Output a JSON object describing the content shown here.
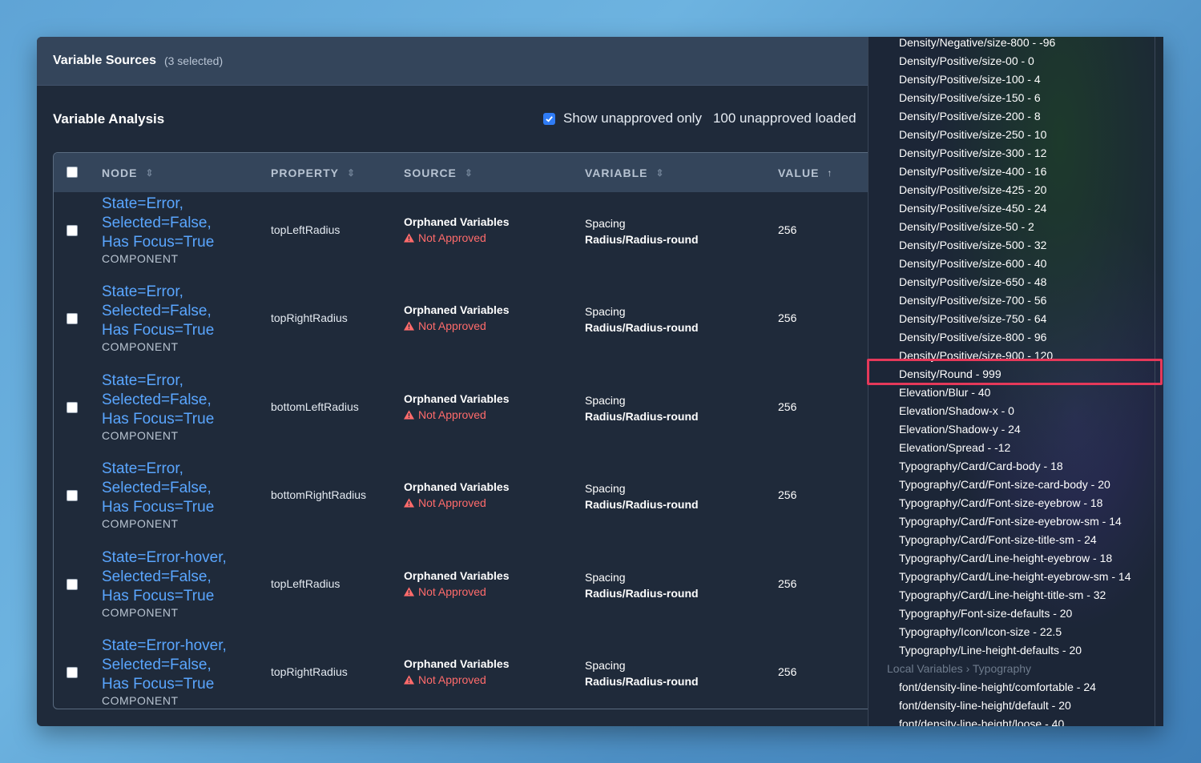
{
  "header": {
    "title": "Variable Sources",
    "selected": "(3 selected)"
  },
  "analysis": {
    "title": "Variable Analysis",
    "show_unapproved_label": "Show unapproved only",
    "loaded_label": "100 unapproved loaded"
  },
  "table": {
    "columns": [
      "NODE",
      "PROPERTY",
      "SOURCE",
      "VARIABLE",
      "VALUE"
    ],
    "rows": [
      {
        "node": [
          "State=Error,",
          "Selected=False,",
          "Has Focus=True"
        ],
        "type": "COMPONENT",
        "property": "topLeftRadius",
        "source": "Orphaned Variables",
        "status": "Not Approved",
        "variable": [
          "Spacing",
          "Radius/Radius-round"
        ],
        "value": "256"
      },
      {
        "node": [
          "State=Error,",
          "Selected=False,",
          "Has Focus=True"
        ],
        "type": "COMPONENT",
        "property": "topRightRadius",
        "source": "Orphaned Variables",
        "status": "Not Approved",
        "variable": [
          "Spacing",
          "Radius/Radius-round"
        ],
        "value": "256"
      },
      {
        "node": [
          "State=Error,",
          "Selected=False,",
          "Has Focus=True"
        ],
        "type": "COMPONENT",
        "property": "bottomLeftRadius",
        "source": "Orphaned Variables",
        "status": "Not Approved",
        "variable": [
          "Spacing",
          "Radius/Radius-round"
        ],
        "value": "256"
      },
      {
        "node": [
          "State=Error,",
          "Selected=False,",
          "Has Focus=True"
        ],
        "type": "COMPONENT",
        "property": "bottomRightRadius",
        "source": "Orphaned Variables",
        "status": "Not Approved",
        "variable": [
          "Spacing",
          "Radius/Radius-round"
        ],
        "value": "256"
      },
      {
        "node": [
          "State=Error-hover,",
          "Selected=False,",
          "Has Focus=True"
        ],
        "type": "COMPONENT",
        "property": "topLeftRadius",
        "source": "Orphaned Variables",
        "status": "Not Approved",
        "variable": [
          "Spacing",
          "Radius/Radius-round"
        ],
        "value": "256"
      },
      {
        "node": [
          "State=Error-hover,",
          "Selected=False,",
          "Has Focus=True"
        ],
        "type": "COMPONENT",
        "property": "topRightRadius",
        "source": "Orphaned Variables",
        "status": "Not Approved",
        "variable": [
          "Spacing",
          "Radius/Radius-round"
        ],
        "value": "256"
      }
    ]
  },
  "dropdown": {
    "items": [
      "Density/Negative/size-800 - -96",
      "Density/Positive/size-00 - 0",
      "Density/Positive/size-100 - 4",
      "Density/Positive/size-150 - 6",
      "Density/Positive/size-200 - 8",
      "Density/Positive/size-250 - 10",
      "Density/Positive/size-300 - 12",
      "Density/Positive/size-400 - 16",
      "Density/Positive/size-425 - 20",
      "Density/Positive/size-450 - 24",
      "Density/Positive/size-50 - 2",
      "Density/Positive/size-500 - 32",
      "Density/Positive/size-600 - 40",
      "Density/Positive/size-650 - 48",
      "Density/Positive/size-700 - 56",
      "Density/Positive/size-750 - 64",
      "Density/Positive/size-800 - 96",
      "Density/Positive/size-900 - 120",
      "Density/Round - 999",
      "Elevation/Blur - 40",
      "Elevation/Shadow-x - 0",
      "Elevation/Shadow-y - 24",
      "Elevation/Spread - -12",
      "Typography/Card/Card-body - 18",
      "Typography/Card/Font-size-card-body - 20",
      "Typography/Card/Font-size-eyebrow - 18",
      "Typography/Card/Font-size-eyebrow-sm - 14",
      "Typography/Card/Font-size-title-sm - 24",
      "Typography/Card/Line-height-eyebrow - 18",
      "Typography/Card/Line-height-eyebrow-sm - 14",
      "Typography/Card/Line-height-title-sm - 32",
      "Typography/Font-size-defaults - 20",
      "Typography/Icon/Icon-size - 22.5",
      "Typography/Line-height-defaults - 20"
    ],
    "group_label": "Local Variables › Typography",
    "group_items": [
      "font/density-line-height/comfortable - 24",
      "font/density-line-height/default - 20",
      "font/density-line-height/loose - 40"
    ],
    "selected_index": 18
  },
  "colors": {
    "accent": "#2f7cf6",
    "link": "#5aa6ff",
    "warning": "#ff6b6b",
    "highlight": "#e5395a"
  }
}
